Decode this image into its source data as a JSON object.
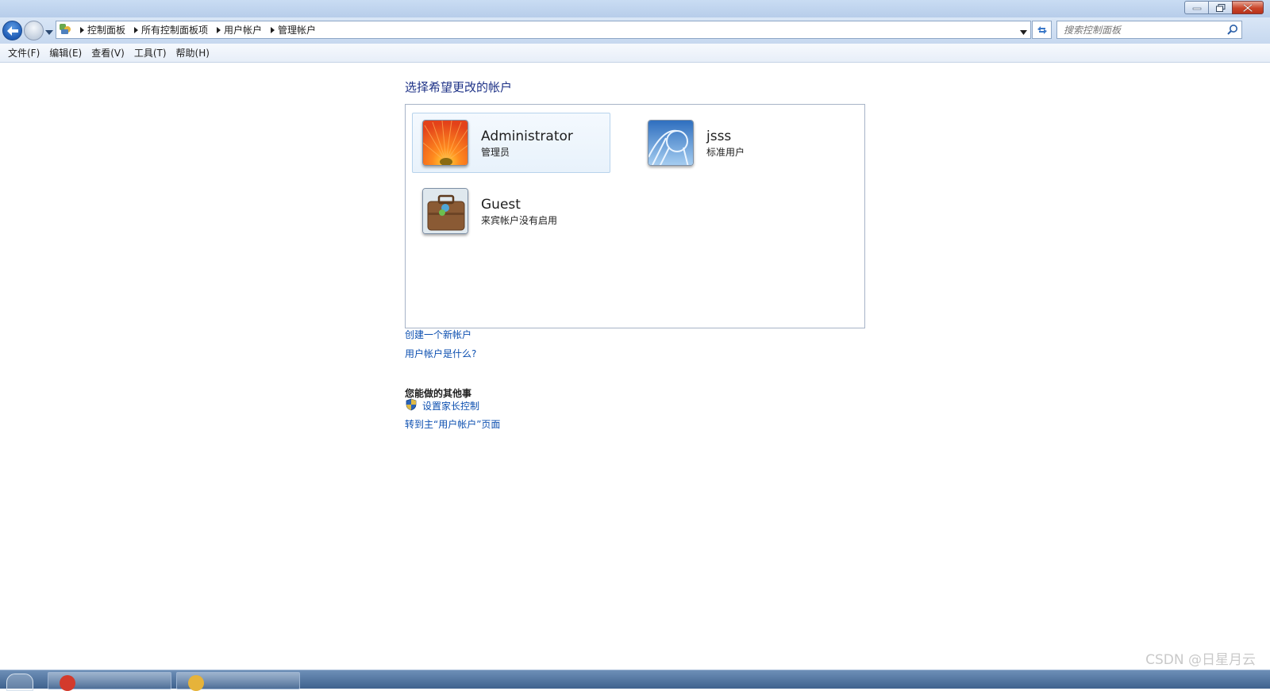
{
  "address_bar": {
    "breadcrumbs": [
      "控制面板",
      "所有控制面板项",
      "用户帐户",
      "管理帐户"
    ],
    "search_placeholder": "搜索控制面板"
  },
  "menu": [
    "文件(F)",
    "编辑(E)",
    "查看(V)",
    "工具(T)",
    "帮助(H)"
  ],
  "main": {
    "heading": "选择希望更改的帐户",
    "accounts": [
      {
        "name": "Administrator",
        "role": "管理员",
        "picture": "orange-flower-icon",
        "selected": true
      },
      {
        "name": "jsss",
        "role": "标准用户",
        "picture": "roller-coaster-icon",
        "selected": false
      },
      {
        "name": "Guest",
        "role": "来宾帐户没有启用",
        "picture": "suitcase-icon",
        "selected": false
      }
    ],
    "links": {
      "create_account": "创建一个新帐户",
      "what_is_account": "用户帐户是什么?"
    },
    "other_heading": "您能做的其他事",
    "other_links": {
      "parental_controls": "设置家长控制",
      "goto_main": "转到主“用户帐户”页面"
    }
  },
  "watermark": "CSDN @日星月云",
  "colors": {
    "link": "#0c4fb0",
    "heading": "#1e3287",
    "selection": "#e8f2fb"
  }
}
